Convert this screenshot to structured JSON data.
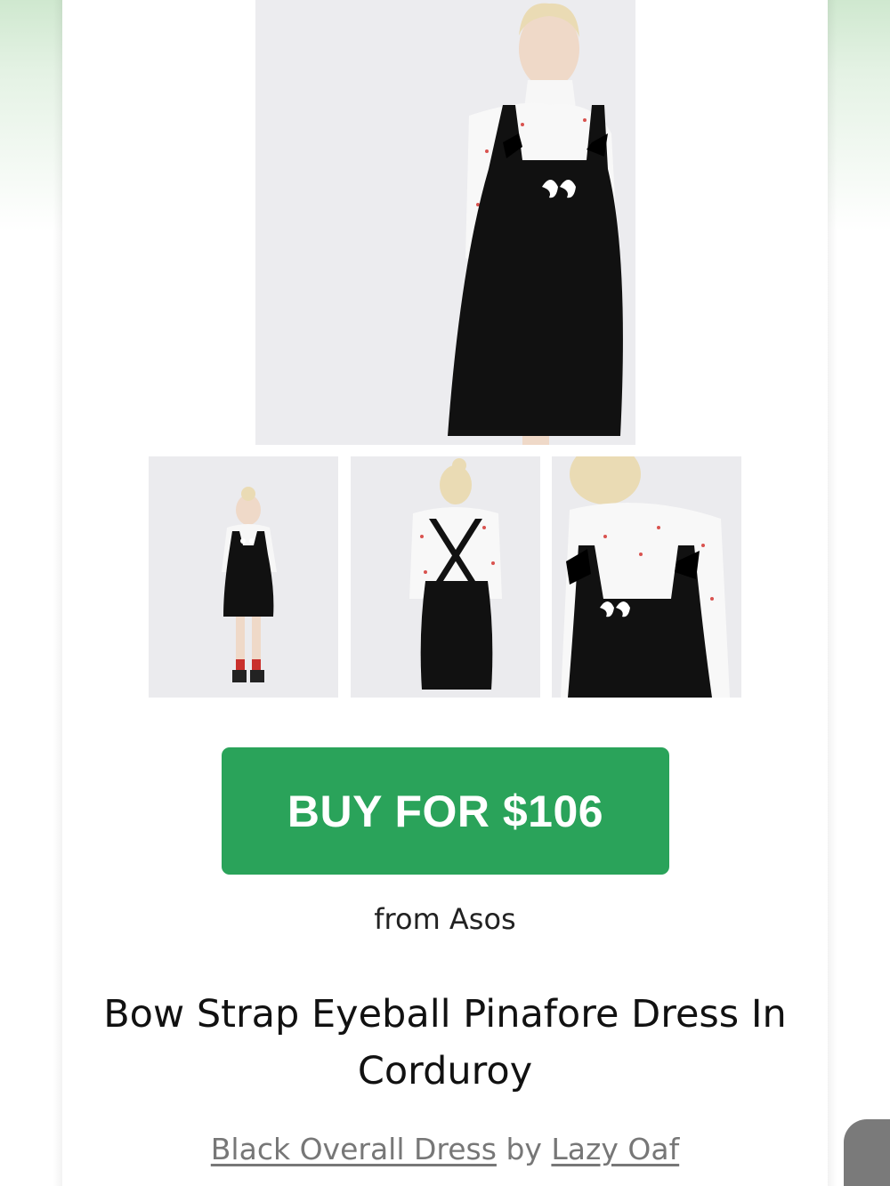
{
  "product": {
    "buy_label": "BUY FOR $106",
    "store_line": "from Asos",
    "title": "Bow Strap Eyeball Pinafore Dress In Corduroy",
    "category_link": "Black Overall Dress",
    "by_text": "by",
    "brand_link": "Lazy Oaf"
  },
  "colors": {
    "buy_button": "#2aa35a",
    "dress": "#111111",
    "photo_background": "#ececef"
  },
  "gallery": {
    "main_photo": "model-front-closeup",
    "thumbnails": [
      "model-full-length-front",
      "model-back-view",
      "model-detail-view"
    ]
  }
}
